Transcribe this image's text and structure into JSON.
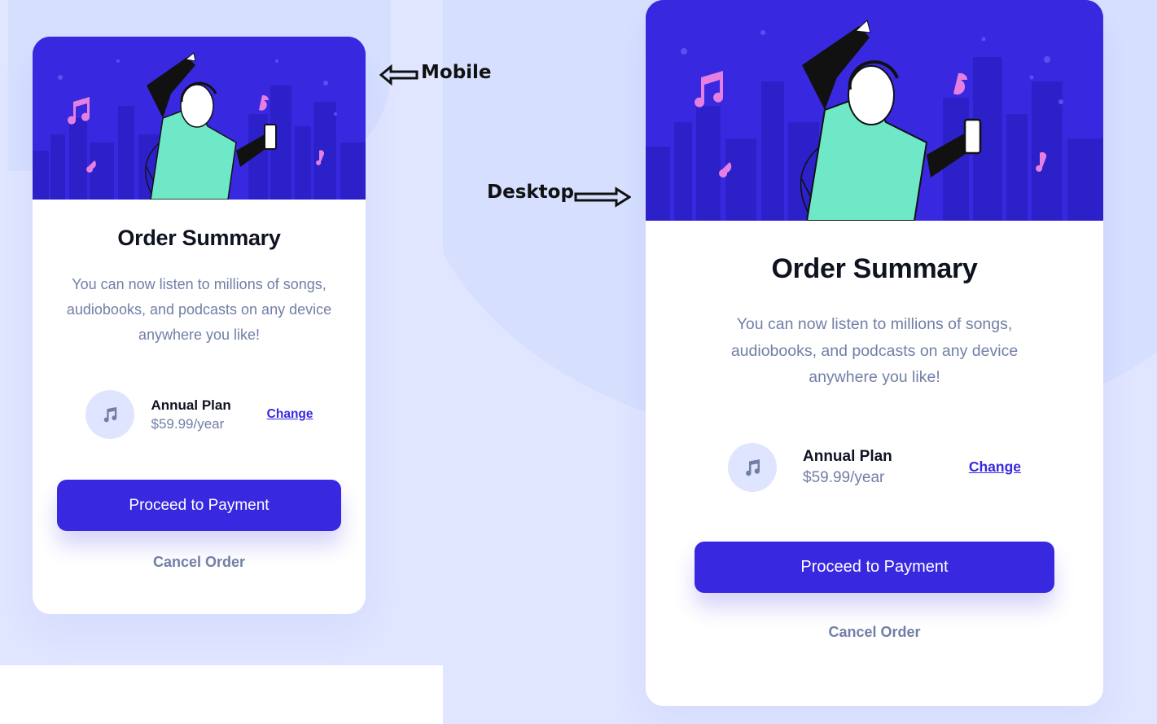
{
  "annotations": {
    "mobile_label": "Mobile",
    "desktop_label": "Desktop"
  },
  "order": {
    "title": "Order Summary",
    "description_mobile": "You can now listen to millions of songs, audiobooks, and podcasts on any device anywhere you like!",
    "description_desktop": "You can now listen to millions of songs, audiobooks, and podcasts on any device anywhere you like!",
    "plan_name": "Annual Plan",
    "plan_price": "$59.99/year",
    "change_label": "Change",
    "pay_label": "Proceed to Payment",
    "cancel_label": "Cancel Order"
  },
  "icons": {
    "plan": "music-note-icon",
    "mobile_arrow": "arrow-left-icon",
    "desktop_arrow": "arrow-right-icon"
  },
  "colors": {
    "brand": "#3829e0",
    "text_muted": "#717fa6",
    "background": "#e0e6ff",
    "icon_bg": "#dfe5ff",
    "hero_accent": "#6fe8c7",
    "note_pink": "#e57fe0"
  }
}
